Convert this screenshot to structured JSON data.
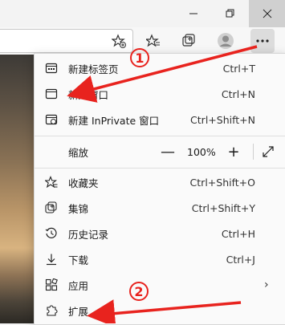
{
  "menu": {
    "items": [
      {
        "label": "新建标签页",
        "shortcut": "Ctrl+T",
        "icon": "new-tab-icon"
      },
      {
        "label": "新建窗口",
        "shortcut": "Ctrl+N",
        "icon": "new-window-icon"
      },
      {
        "label": "新建 InPrivate 窗口",
        "shortcut": "Ctrl+Shift+N",
        "icon": "inprivate-icon"
      },
      {
        "label": "缩放",
        "icon": "none"
      },
      {
        "label": "收藏夹",
        "shortcut": "Ctrl+Shift+O",
        "icon": "favorites-icon"
      },
      {
        "label": "集锦",
        "shortcut": "Ctrl+Shift+Y",
        "icon": "collections-icon"
      },
      {
        "label": "历史记录",
        "shortcut": "Ctrl+H",
        "icon": "history-icon"
      },
      {
        "label": "下载",
        "shortcut": "Ctrl+J",
        "icon": "download-icon"
      },
      {
        "label": "应用",
        "shortcut": "",
        "icon": "apps-icon"
      },
      {
        "label": "扩展",
        "shortcut": "",
        "icon": "extensions-icon"
      }
    ],
    "zoom": {
      "value": "100%",
      "minus": "—",
      "plus": "+"
    }
  },
  "annotations": {
    "badge1": "1",
    "badge2": "2",
    "color": "#e8231e"
  }
}
